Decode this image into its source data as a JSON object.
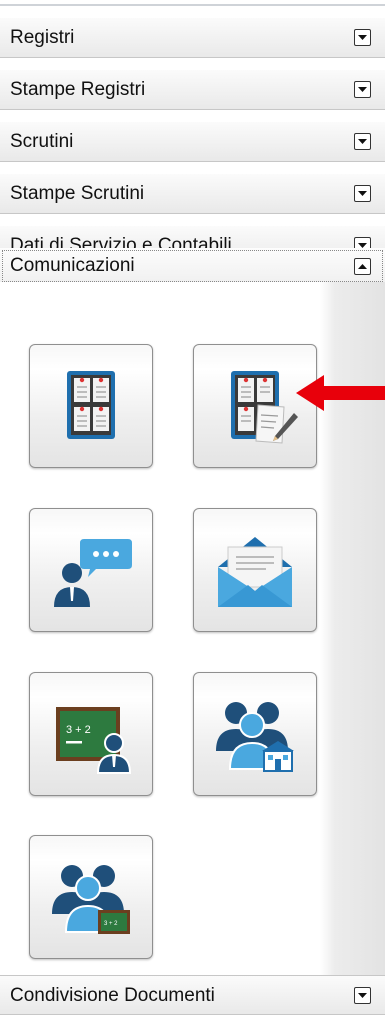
{
  "menu": {
    "registri": "Registri",
    "stampe_registri": "Stampe Registri",
    "scrutini": "Scrutini",
    "stampe_scrutini": "Stampe Scrutini",
    "dati_servizio": "Dati di Servizio e Contabili",
    "comunicazioni": "Comunicazioni",
    "condivisione": "Condivisione Documenti"
  },
  "tiles": [
    {
      "icon": "bulletin-board-icon"
    },
    {
      "icon": "bulletin-board-edit-icon"
    },
    {
      "icon": "person-chat-icon"
    },
    {
      "icon": "envelope-icon"
    },
    {
      "icon": "chalkboard-teacher-icon"
    },
    {
      "icon": "people-school-icon"
    },
    {
      "icon": "people-chalkboard-icon"
    }
  ],
  "colors": {
    "arrow": "#e8000b",
    "icon_blue": "#1f6fae",
    "icon_light_blue": "#4aa8df",
    "chalkboard_green": "#2d7a3f"
  }
}
